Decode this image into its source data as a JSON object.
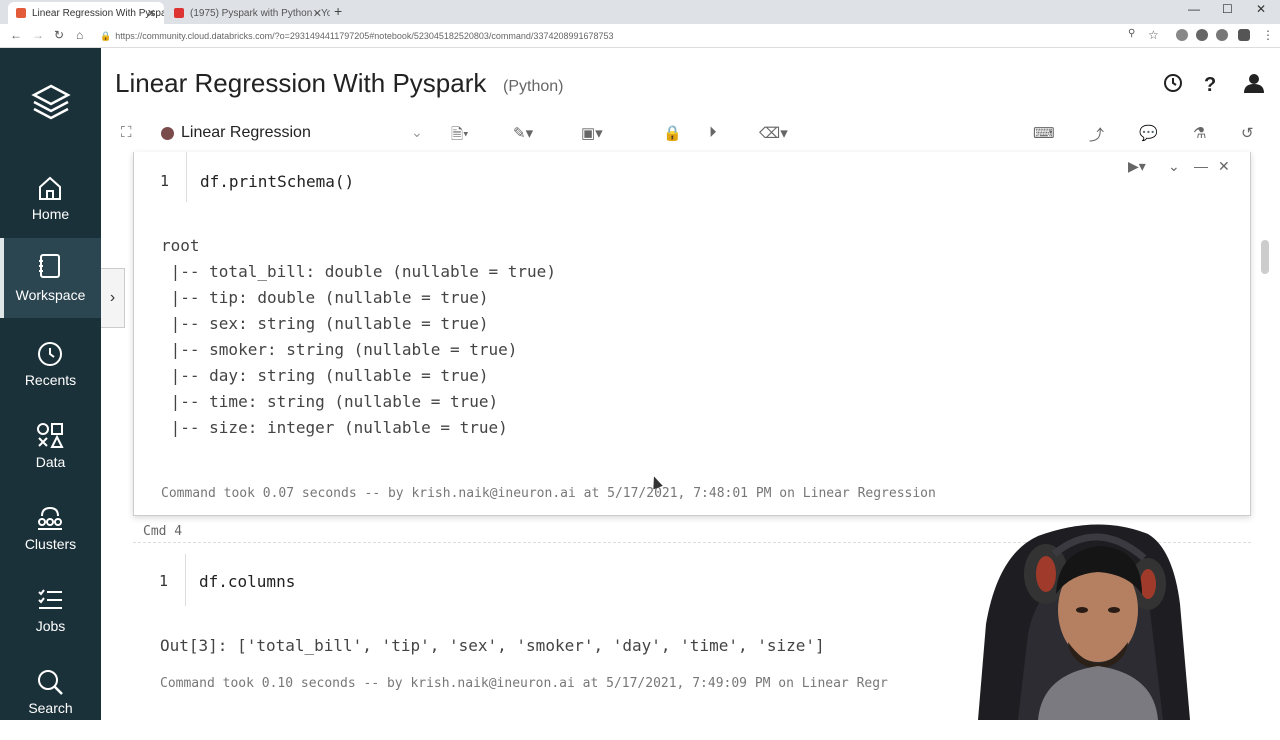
{
  "browser": {
    "tabs": [
      {
        "title": "Linear Regression With Pyspark",
        "active": true
      },
      {
        "title": "(1975) Pyspark with Python - Yo",
        "active": false
      }
    ],
    "url": "https://community.cloud.databricks.com/?o=2931494411797205#notebook/523045182520803/command/3374208991678753"
  },
  "sidebar": {
    "items": [
      {
        "label": "Home",
        "icon": "home-icon"
      },
      {
        "label": "Workspace",
        "icon": "workspace-icon"
      },
      {
        "label": "Recents",
        "icon": "clock-icon"
      },
      {
        "label": "Data",
        "icon": "data-icon"
      },
      {
        "label": "Clusters",
        "icon": "clusters-icon"
      },
      {
        "label": "Jobs",
        "icon": "jobs-icon"
      },
      {
        "label": "Search",
        "icon": "search-icon"
      }
    ],
    "active": "Workspace"
  },
  "notebook": {
    "title": "Linear Regression With Pyspark",
    "language": "(Python)",
    "cluster": "Linear Regression"
  },
  "cell1": {
    "line": "1",
    "code": "df.printSchema()",
    "output": [
      "root",
      " |-- total_bill: double (nullable = true)",
      " |-- tip: double (nullable = true)",
      " |-- sex: string (nullable = true)",
      " |-- smoker: string (nullable = true)",
      " |-- day: string (nullable = true)",
      " |-- time: string (nullable = true)",
      " |-- size: integer (nullable = true)"
    ],
    "info": "Command took 0.07 seconds -- by krish.naik@ineuron.ai at 5/17/2021, 7:48:01 PM on Linear Regression"
  },
  "cell2": {
    "cmd_label": "Cmd 4",
    "line": "1",
    "code": "df.columns",
    "output": "Out[3]: ['total_bill', 'tip', 'sex', 'smoker', 'day', 'time', 'size']",
    "info": "Command took 0.10 seconds -- by krish.naik@ineuron.ai at 5/17/2021, 7:49:09 PM on Linear Regr"
  },
  "colors": {
    "sidebar_bg": "#1b3139",
    "sidebar_active": "#2b4650",
    "cluster_dot": "#7a4b4b"
  }
}
